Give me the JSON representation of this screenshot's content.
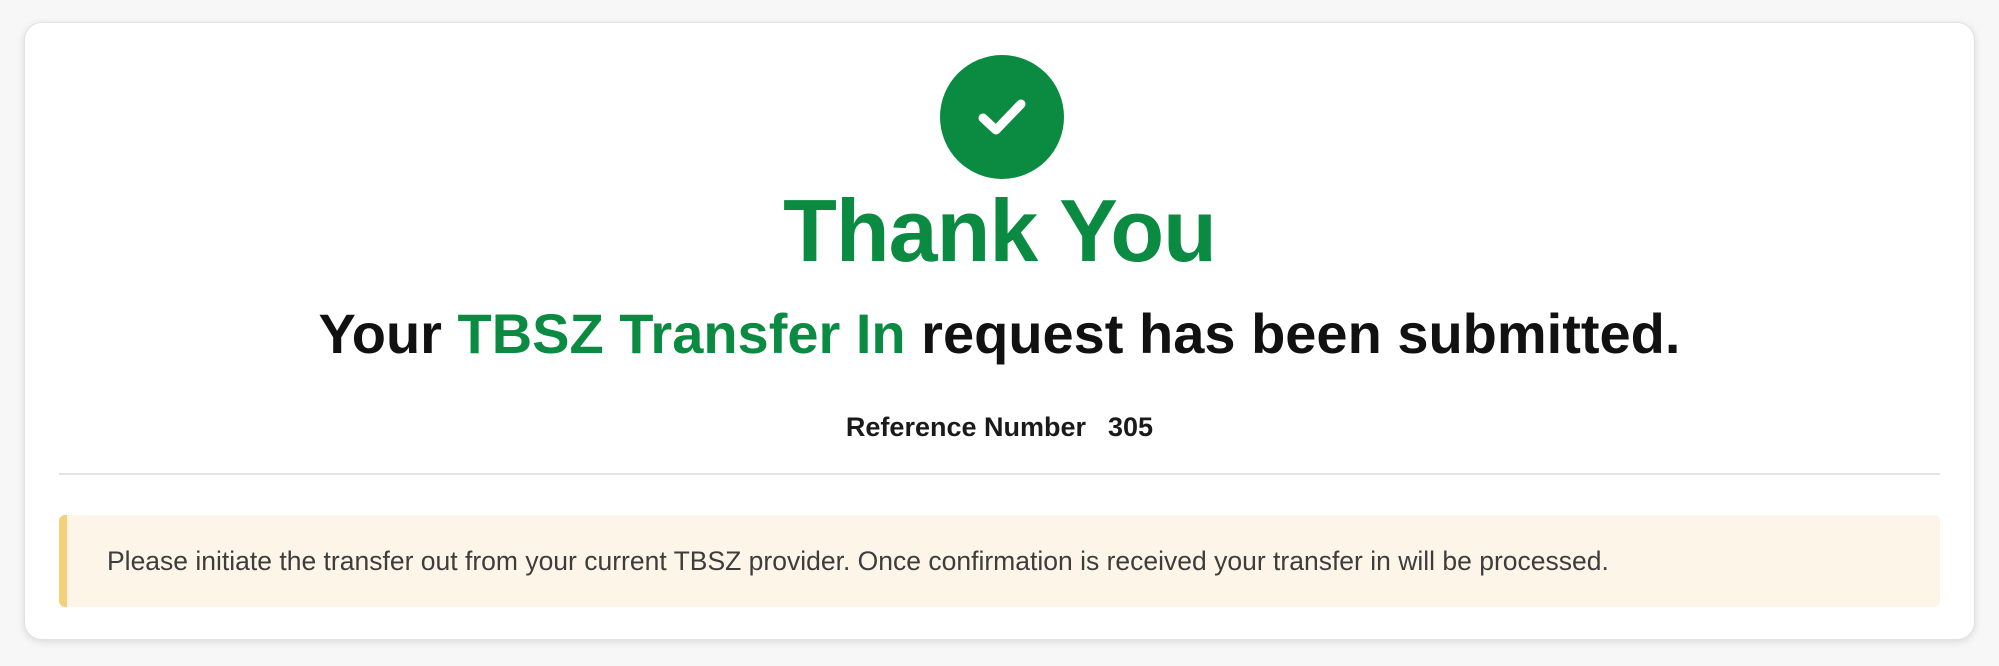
{
  "confirmation": {
    "success_icon": "check-circle-icon",
    "title": "Thank You",
    "message_prefix": "Your ",
    "message_highlight": "TBSZ Transfer In",
    "message_suffix": " request has been submitted.",
    "reference_label": "Reference Number",
    "reference_value": "305"
  },
  "notice": {
    "text": "Please initiate the transfer out from your current TBSZ provider. Once confirmation is received your transfer in will be processed."
  },
  "colors": {
    "accent_green": "#0b8a42",
    "notice_background": "#fdf5e8",
    "notice_border": "#f5d07a"
  }
}
